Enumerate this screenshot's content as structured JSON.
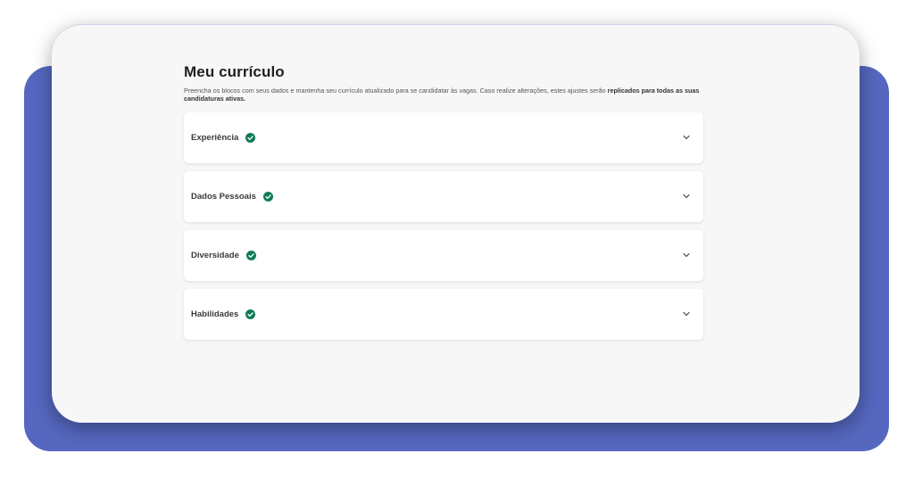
{
  "page": {
    "title": "Meu currículo",
    "description_plain": "Preencha os blocos com seus dados e mantenha seu currículo atualizado para se candidatar às vagas. Caso realize alterações, estes ajustes serão",
    "description_bold": "replicados para todas as suas candidaturas ativas."
  },
  "sections": [
    {
      "label": "Experiência",
      "status_icon": "check-circle-icon",
      "expand_icon": "chevron-down-icon"
    },
    {
      "label": "Dados Pessoais",
      "status_icon": "check-circle-icon",
      "expand_icon": "chevron-down-icon"
    },
    {
      "label": "Diversidade",
      "status_icon": "check-circle-icon",
      "expand_icon": "chevron-down-icon"
    },
    {
      "label": "Habilidades",
      "status_icon": "check-circle-icon",
      "expand_icon": "chevron-down-icon"
    }
  ],
  "colors": {
    "backdrop": "#5567bf",
    "card_background": "#f7f7f7",
    "check_green": "#0f7a5a",
    "title_text": "#1f1f1f"
  }
}
